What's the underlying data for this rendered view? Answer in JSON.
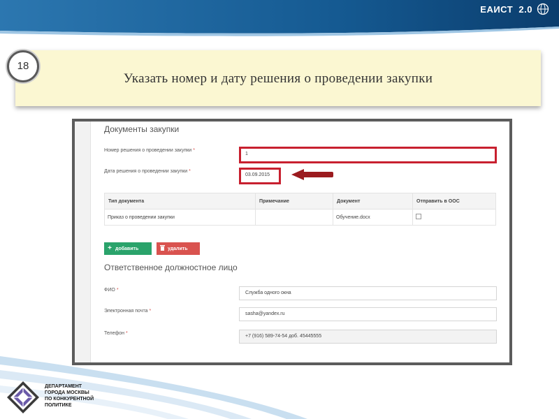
{
  "header": {
    "brand": "ЕАИСТ  2.0"
  },
  "slide": {
    "number": "18",
    "title": "Указать номер и дату решения о проведении закупки"
  },
  "form": {
    "section_docs": "Документы закупки",
    "decision_number_label": "Номер решения о проведении закупки",
    "decision_number_value": "1",
    "decision_date_label": "Дата решения о проведении закупки",
    "decision_date_value": "03.09.2015",
    "required_mark": "*",
    "table": {
      "headers": [
        "Тип документа",
        "Примечание",
        "Документ",
        "Отправить в ООС"
      ],
      "rows": [
        {
          "type": "Приказ о проведении закупки",
          "note": "",
          "document": "Обучение.docx",
          "send": false
        }
      ]
    },
    "add_label": "добавить",
    "delete_label": "удалить",
    "section_responsible": "Ответственное должностное лицо",
    "fio_label": "ФИО",
    "fio_value": "Служба одного окна",
    "email_label": "Электронная почта",
    "email_value": "sasha@yandex.ru",
    "phone_label": "Телефон",
    "phone_value": "+7 (916) 589-74-54 доб. 45445555"
  },
  "footer": {
    "logo_line_1": "ДЕПАРТАМЕНТ",
    "logo_line_2": "ГОРОДА МОСКВЫ",
    "logo_line_3": "ПО КОНКУРЕНТНОЙ",
    "logo_line_4": "ПОЛИТИКЕ"
  },
  "colors": {
    "header_blue": "#0e4f86",
    "card_bg": "#fbf7d2",
    "highlight_red": "#c8202f",
    "arrow_red": "#9b1b1f",
    "add_green": "#2aa36b",
    "delete_red": "#d9534f"
  },
  "icons": [
    "globe-icon",
    "plus-icon",
    "trash-icon",
    "arrow-left-icon",
    "department-logo-icon"
  ]
}
